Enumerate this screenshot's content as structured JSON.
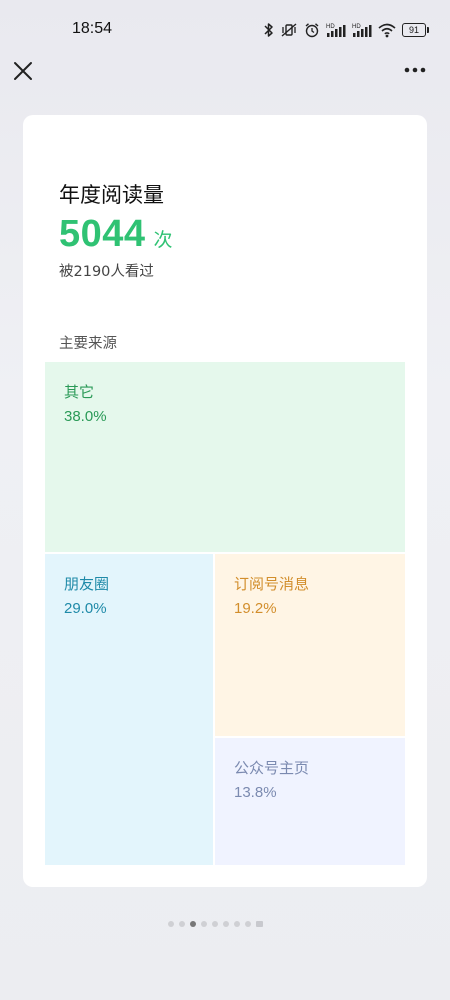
{
  "status_bar": {
    "time": "18:54",
    "battery": "91",
    "icons": [
      "bluetooth-icon",
      "vibrate-off-icon",
      "alarm-icon",
      "signal-hd-icon",
      "signal-hd-icon",
      "wifi-icon",
      "battery-icon"
    ]
  },
  "nav": {
    "close_icon": "close-icon",
    "more_icon": "more-icon"
  },
  "card": {
    "title": "年度阅读量",
    "count": "5044",
    "count_unit": "次",
    "viewers": "被2190人看过",
    "section_label": "主要来源",
    "sources": [
      {
        "name": "其它",
        "percent": "38.0%",
        "color": "#e5f8ec"
      },
      {
        "name": "朋友圈",
        "percent": "29.0%",
        "color": "#e3f5fc"
      },
      {
        "name": "订阅号消息",
        "percent": "19.2%",
        "color": "#fff5e5"
      },
      {
        "name": "公众号主页",
        "percent": "13.8%",
        "color": "#f0f3ff"
      }
    ]
  },
  "pager": {
    "total": 9,
    "active_index": 2
  },
  "colors": {
    "accent": "#2fc273"
  }
}
